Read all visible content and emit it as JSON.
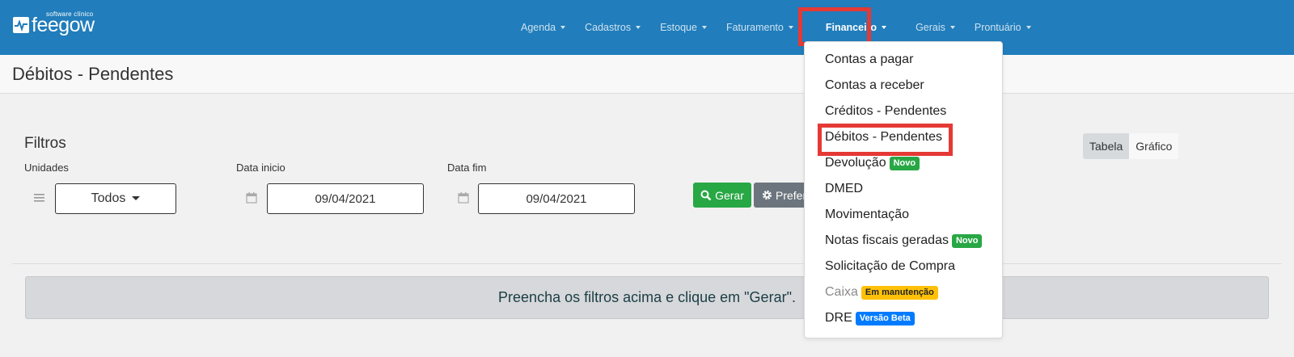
{
  "brand": {
    "subtitle": "software clínico",
    "name": "feegow"
  },
  "nav": {
    "items": [
      {
        "label": "Agenda",
        "active": false
      },
      {
        "label": "Cadastros",
        "active": false
      },
      {
        "label": "Estoque",
        "active": false
      },
      {
        "label": "Faturamento",
        "active": false
      },
      {
        "label": "Financeiro",
        "active": true
      },
      {
        "label": "Gerais",
        "active": false
      },
      {
        "label": "Prontuário",
        "active": false
      }
    ]
  },
  "page": {
    "title": "Débitos - Pendentes"
  },
  "filters": {
    "title": "Filtros",
    "unidades_label": "Unidades",
    "unidades_value": "Todos",
    "data_inicio_label": "Data inicio",
    "data_inicio_value": "09/04/2021",
    "data_fim_label": "Data fim",
    "data_fim_value": "09/04/2021",
    "gerar_label": "Gerar",
    "preferencias_label": "Preferências"
  },
  "view_toggle": {
    "tabela": "Tabela",
    "grafico": "Gráfico"
  },
  "alert": {
    "message": "Preencha os filtros acima e clique em \"Gerar\"."
  },
  "financeiro_menu": {
    "items": [
      {
        "label": "Contas a pagar"
      },
      {
        "label": "Contas a receber"
      },
      {
        "label": "Créditos - Pendentes"
      },
      {
        "label": "Débitos - Pendentes"
      },
      {
        "label": "Devolução",
        "badge": "Novo",
        "badge_color": "#28a745"
      },
      {
        "label": "DMED"
      },
      {
        "label": "Movimentação"
      },
      {
        "label": "Notas fiscais geradas",
        "badge": "Novo",
        "badge_color": "#28a745"
      },
      {
        "label": "Solicitação de Compra"
      },
      {
        "label": "Caixa",
        "badge": "Em manutenção",
        "badge_color": "#ffc107"
      },
      {
        "label": "DRE",
        "badge": "Versão Beta",
        "badge_color": "#007bff"
      }
    ]
  },
  "colors": {
    "navbar": "#217dbb",
    "highlight": "#e53935",
    "success": "#28a745",
    "secondary": "#6c757d"
  }
}
